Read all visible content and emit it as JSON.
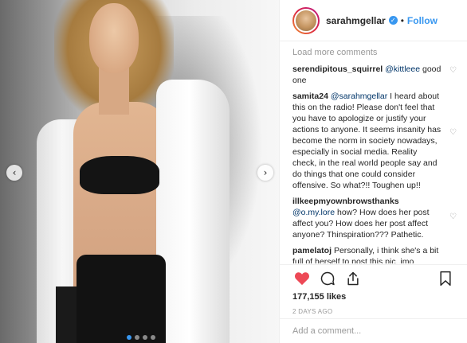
{
  "post": {
    "username": "sarahmgellar",
    "follow_label": "Follow",
    "bullet": "•",
    "load_more": "Load more comments",
    "likes": "177,155 likes",
    "age": "2 DAYS AGO",
    "add_comment_placeholder": "Add a comment...",
    "comments": [
      {
        "user": "serendipitous_squirrel",
        "mention": "@kittleee",
        "text": "good one"
      },
      {
        "user": "samita24",
        "mention": "@sarahmgellar",
        "text": "I heard about this on the radio! Please don't feel that you have to apologize or justify your actions to anyone. It seems insanity has become the norm in society nowadays, especially in social media. Reality check, in the real world people say and do things that one could consider offensive. So what?!! Toughen up!!"
      },
      {
        "user": "illkeepmyownbrowsthanks",
        "mention": "@o.my.lore",
        "text": "how? How does her post affect you? How does her post affect anyone? Thinspiration??? Pathetic."
      },
      {
        "user": "pamelatoj",
        "mention": "",
        "text": "Personally, i think she's a bit full of herself to post this pic..jmo"
      }
    ]
  },
  "carousel": {
    "slide_count": 4,
    "active_index": 0
  },
  "colors": {
    "accent": "#3897f0",
    "like_red": "#ed4956",
    "muted": "#999999"
  },
  "icons": [
    "chevron-left-icon",
    "chevron-right-icon",
    "verified-badge-icon",
    "heart-icon",
    "comment-icon",
    "share-icon",
    "bookmark-icon"
  ]
}
